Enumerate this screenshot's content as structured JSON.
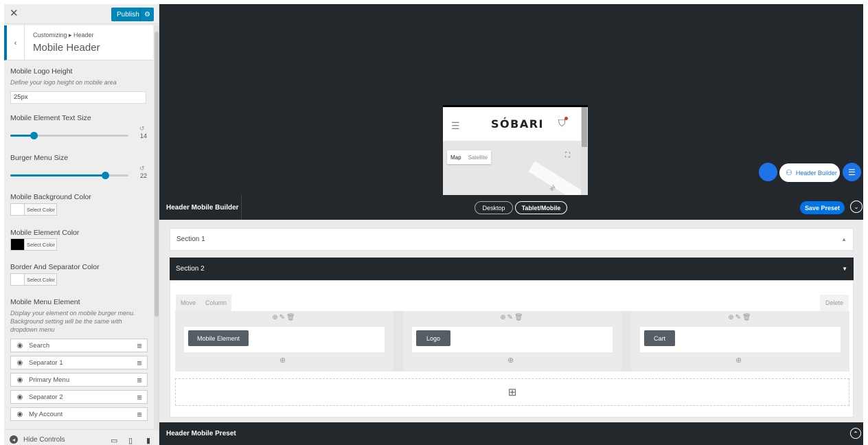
{
  "topbar": {
    "publish_label": "Publish"
  },
  "breadcrumb": {
    "path": "Customizing ▸ Header",
    "title": "Mobile Header"
  },
  "controls": {
    "logo_height": {
      "title": "Mobile Logo Height",
      "desc": "Define your logo height on mobile area",
      "value": "25px"
    },
    "text_size": {
      "title": "Mobile Element Text Size",
      "value": "14",
      "percent": 20
    },
    "burger_size": {
      "title": "Burger Menu Size",
      "value": "22",
      "percent": 80
    },
    "bg_color": {
      "title": "Mobile Background Color",
      "btn": "Select Color",
      "swatch": "#ffffff"
    },
    "el_color": {
      "title": "Mobile Element Color",
      "btn": "Select Color",
      "swatch": "#000000"
    },
    "border_color": {
      "title": "Border And Separator Color",
      "btn": "Select Color",
      "swatch": "#ffffff"
    },
    "menu_element": {
      "title": "Mobile Menu Element",
      "desc": "Display your element on mobile burger menu. Background setting will be the same with dropdown menu",
      "items": [
        "Search",
        "Separator 1",
        "Primary Menu",
        "Separator 2",
        "My Account"
      ]
    }
  },
  "bottombar": {
    "hide_controls": "Hide Controls"
  },
  "preview": {
    "logo": "SÓBARI",
    "map_tab_map": "Map",
    "map_tab_satellite": "Satellite",
    "street_label": "ay",
    "header_builder_label": "Header Builder"
  },
  "builder": {
    "title": "Header Mobile Builder",
    "desktop": "Desktop",
    "tablet_mobile": "Tablet/Mobile",
    "save_preset": "Save Preset",
    "section1": "Section 1",
    "section2": "Section 2",
    "tab_move": "Move",
    "tab_column": "Column",
    "delete": "Delete",
    "columns": [
      {
        "element": "Mobile Element"
      },
      {
        "element": "Logo"
      },
      {
        "element": "Cart"
      }
    ],
    "preset_title": "Header Mobile Preset"
  },
  "colors": {
    "accent": "#0085ba",
    "dark": "#23282d",
    "builder_blue": "#1e73e8"
  }
}
